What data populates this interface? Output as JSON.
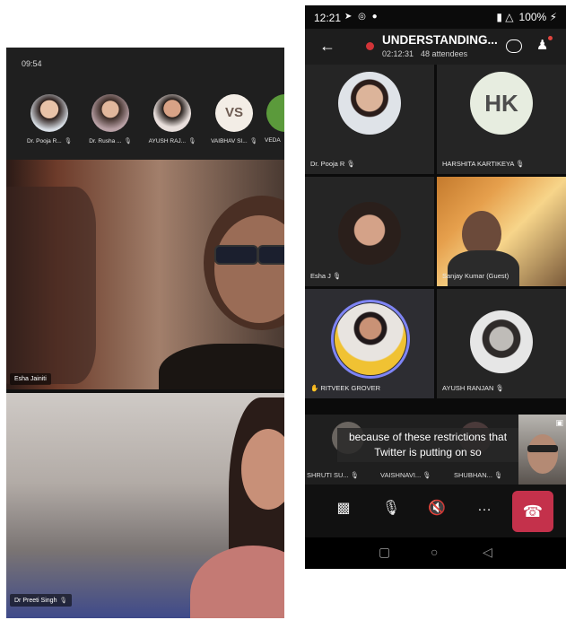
{
  "left": {
    "clock": "09:54",
    "participants": [
      {
        "label": "Dr. Pooja R..."
      },
      {
        "label": "Dr. Rusha ..."
      },
      {
        "label": "AYUSH RAJ..."
      },
      {
        "label": "VAIBHAV SI...",
        "initials": "VS"
      },
      {
        "label": "VEDA"
      }
    ],
    "videos": [
      {
        "name": "Esha Jainiti"
      },
      {
        "name": "Dr Preeti Singh"
      }
    ]
  },
  "phone": {
    "status": {
      "time": "12:21",
      "battery": "100%"
    },
    "header": {
      "title": "UNDERSTANDING...",
      "duration": "02:12:31",
      "attendees": "48 attendees"
    },
    "tiles": [
      {
        "name": "Dr. Pooja R"
      },
      {
        "name": "HARSHITA KARTIKEYA",
        "initials": "HK"
      },
      {
        "name": "Esha J"
      },
      {
        "name": "Sanjay Kumar (Guest)"
      },
      {
        "name": "RITVEEK GROVER"
      },
      {
        "name": "AYUSH RANJAN"
      }
    ],
    "overflow": [
      {
        "name": "SHRUTI SU..."
      },
      {
        "name": "VAISHNAVI..."
      },
      {
        "name": "SHUBHAN..."
      }
    ],
    "caption": "because of these restrictions that Twitter is putting on so"
  }
}
